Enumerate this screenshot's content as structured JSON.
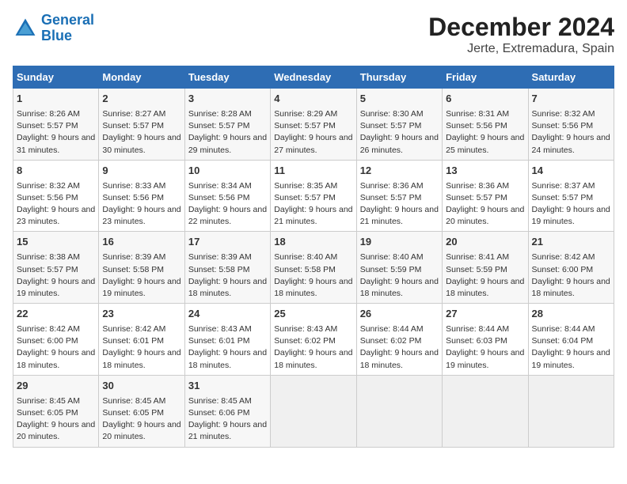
{
  "logo": {
    "line1": "General",
    "line2": "Blue"
  },
  "title": "December 2024",
  "subtitle": "Jerte, Extremadura, Spain",
  "days_of_week": [
    "Sunday",
    "Monday",
    "Tuesday",
    "Wednesday",
    "Thursday",
    "Friday",
    "Saturday"
  ],
  "weeks": [
    [
      {
        "day": "1",
        "sunrise": "8:26 AM",
        "sunset": "5:57 PM",
        "daylight": "9 hours and 31 minutes."
      },
      {
        "day": "2",
        "sunrise": "8:27 AM",
        "sunset": "5:57 PM",
        "daylight": "9 hours and 30 minutes."
      },
      {
        "day": "3",
        "sunrise": "8:28 AM",
        "sunset": "5:57 PM",
        "daylight": "9 hours and 29 minutes."
      },
      {
        "day": "4",
        "sunrise": "8:29 AM",
        "sunset": "5:57 PM",
        "daylight": "9 hours and 27 minutes."
      },
      {
        "day": "5",
        "sunrise": "8:30 AM",
        "sunset": "5:57 PM",
        "daylight": "9 hours and 26 minutes."
      },
      {
        "day": "6",
        "sunrise": "8:31 AM",
        "sunset": "5:56 PM",
        "daylight": "9 hours and 25 minutes."
      },
      {
        "day": "7",
        "sunrise": "8:32 AM",
        "sunset": "5:56 PM",
        "daylight": "9 hours and 24 minutes."
      }
    ],
    [
      {
        "day": "8",
        "sunrise": "8:32 AM",
        "sunset": "5:56 PM",
        "daylight": "9 hours and 23 minutes."
      },
      {
        "day": "9",
        "sunrise": "8:33 AM",
        "sunset": "5:56 PM",
        "daylight": "9 hours and 23 minutes."
      },
      {
        "day": "10",
        "sunrise": "8:34 AM",
        "sunset": "5:56 PM",
        "daylight": "9 hours and 22 minutes."
      },
      {
        "day": "11",
        "sunrise": "8:35 AM",
        "sunset": "5:57 PM",
        "daylight": "9 hours and 21 minutes."
      },
      {
        "day": "12",
        "sunrise": "8:36 AM",
        "sunset": "5:57 PM",
        "daylight": "9 hours and 21 minutes."
      },
      {
        "day": "13",
        "sunrise": "8:36 AM",
        "sunset": "5:57 PM",
        "daylight": "9 hours and 20 minutes."
      },
      {
        "day": "14",
        "sunrise": "8:37 AM",
        "sunset": "5:57 PM",
        "daylight": "9 hours and 19 minutes."
      }
    ],
    [
      {
        "day": "15",
        "sunrise": "8:38 AM",
        "sunset": "5:57 PM",
        "daylight": "9 hours and 19 minutes."
      },
      {
        "day": "16",
        "sunrise": "8:39 AM",
        "sunset": "5:58 PM",
        "daylight": "9 hours and 19 minutes."
      },
      {
        "day": "17",
        "sunrise": "8:39 AM",
        "sunset": "5:58 PM",
        "daylight": "9 hours and 18 minutes."
      },
      {
        "day": "18",
        "sunrise": "8:40 AM",
        "sunset": "5:58 PM",
        "daylight": "9 hours and 18 minutes."
      },
      {
        "day": "19",
        "sunrise": "8:40 AM",
        "sunset": "5:59 PM",
        "daylight": "9 hours and 18 minutes."
      },
      {
        "day": "20",
        "sunrise": "8:41 AM",
        "sunset": "5:59 PM",
        "daylight": "9 hours and 18 minutes."
      },
      {
        "day": "21",
        "sunrise": "8:42 AM",
        "sunset": "6:00 PM",
        "daylight": "9 hours and 18 minutes."
      }
    ],
    [
      {
        "day": "22",
        "sunrise": "8:42 AM",
        "sunset": "6:00 PM",
        "daylight": "9 hours and 18 minutes."
      },
      {
        "day": "23",
        "sunrise": "8:42 AM",
        "sunset": "6:01 PM",
        "daylight": "9 hours and 18 minutes."
      },
      {
        "day": "24",
        "sunrise": "8:43 AM",
        "sunset": "6:01 PM",
        "daylight": "9 hours and 18 minutes."
      },
      {
        "day": "25",
        "sunrise": "8:43 AM",
        "sunset": "6:02 PM",
        "daylight": "9 hours and 18 minutes."
      },
      {
        "day": "26",
        "sunrise": "8:44 AM",
        "sunset": "6:02 PM",
        "daylight": "9 hours and 18 minutes."
      },
      {
        "day": "27",
        "sunrise": "8:44 AM",
        "sunset": "6:03 PM",
        "daylight": "9 hours and 19 minutes."
      },
      {
        "day": "28",
        "sunrise": "8:44 AM",
        "sunset": "6:04 PM",
        "daylight": "9 hours and 19 minutes."
      }
    ],
    [
      {
        "day": "29",
        "sunrise": "8:45 AM",
        "sunset": "6:05 PM",
        "daylight": "9 hours and 20 minutes."
      },
      {
        "day": "30",
        "sunrise": "8:45 AM",
        "sunset": "6:05 PM",
        "daylight": "9 hours and 20 minutes."
      },
      {
        "day": "31",
        "sunrise": "8:45 AM",
        "sunset": "6:06 PM",
        "daylight": "9 hours and 21 minutes."
      },
      null,
      null,
      null,
      null
    ]
  ]
}
